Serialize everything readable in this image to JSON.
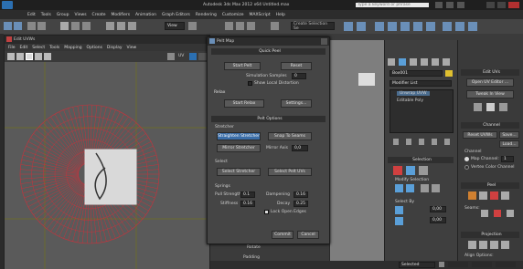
{
  "app": {
    "title": "Autodesk 3ds Max 2012 x64    Untitled.max",
    "search_placeholder": "Type a keyword or phrase",
    "menu": [
      "Edit",
      "Tools",
      "Group",
      "Views",
      "Create",
      "Modifiers",
      "Animation",
      "Graph Editors",
      "Rendering",
      "Customize",
      "MAXScript",
      "Help"
    ],
    "view_dropdown": "View",
    "selection_set": "Create Selection Se"
  },
  "uvw": {
    "title": "Edit UVWs",
    "menu": [
      "File",
      "Edit",
      "Select",
      "Tools",
      "Mapping",
      "Options",
      "Display",
      "View"
    ],
    "uv_label": "UV",
    "bottom_labels": [
      "Rotate",
      "Padding",
      "Custom"
    ]
  },
  "pelt": {
    "title": "Pelt Map",
    "quick_peel": {
      "header": "Quick Peel",
      "start_pelt": "Start Pelt",
      "reset": "Reset",
      "sim_label": "Simulation Samples",
      "sim_value": "0",
      "show_local": "Show Local Distortion"
    },
    "relax": {
      "header": "Relax",
      "start_relax": "Start Relax",
      "settings": "Settings..."
    },
    "pelt_options": {
      "header": "Pelt Options",
      "stretcher_label": "Stretcher",
      "straighten": "Straighten Stretcher",
      "snap_to_seams": "Snap To Seams",
      "mirror_stretcher": "Mirror Stretcher",
      "mirror_axis_label": "Mirror Axis",
      "mirror_axis_value": "0,0",
      "select_label": "Select",
      "select_stretcher": "Select Stretcher",
      "select_pelt_uvs": "Select Pelt UVs",
      "springs_label": "Springs",
      "pull_strength_label": "Pull Strength",
      "pull_strength_value": "0.1",
      "dampening_label": "Dampening",
      "dampening_value": "0.16",
      "stiffness_label": "Stiffness",
      "stiffness_value": "0.16",
      "decay_label": "Decay",
      "decay_value": "0.25",
      "lock_open_edges": "Lock Open Edges"
    },
    "commit": "Commit",
    "cancel": "Cancel"
  },
  "command_panel": {
    "object_name": "Box001",
    "modifier_list": "Modifier List",
    "stack": [
      "Unwrap UVW",
      "Editable Poly"
    ],
    "selection_header": "Selection",
    "modify_selection_label": "Modify Selection",
    "select_by_label": "Select By",
    "field_value_1": "0,00",
    "field_value_2": "0,00"
  },
  "right_panel": {
    "edit_uvs_header": "Edit UVs",
    "open_uv_editor": "Open UV Editor ...",
    "tweak_in_view": "Tweak In View",
    "channel_header": "Channel",
    "reset_uvws": "Reset UVWs",
    "save": "Save...",
    "load": "Load...",
    "channel_label": "Channel",
    "map_channel": "Map Channel:",
    "map_channel_value": "1",
    "vertex_color_channel": "Vertex Color Channel",
    "peel_header": "Peel",
    "seams_label": "Seams:",
    "projection_header": "Projection",
    "align_options": "Align Options:"
  },
  "status": {
    "selected": "Selected"
  },
  "colors": {
    "accent": "#3b6ea8",
    "viewport_bg": "#7e7e7e",
    "uv_lines": "#c8323c"
  }
}
